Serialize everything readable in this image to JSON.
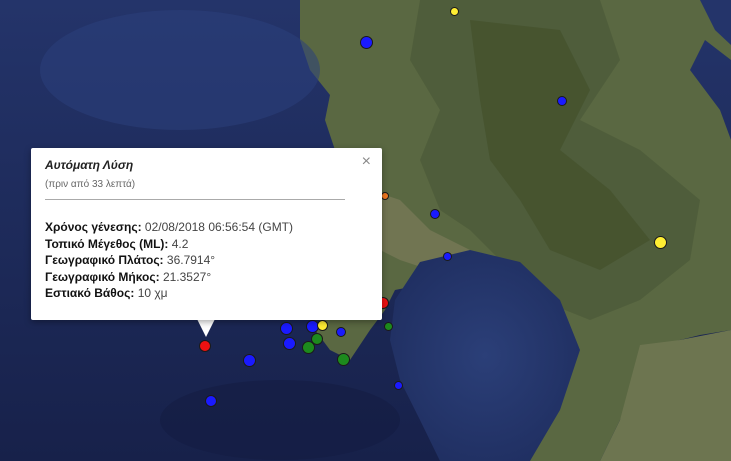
{
  "popup": {
    "close_icon": "×",
    "title": "Αυτόματη Λύση",
    "subtitle": "(πριν από 33 λεπτά)",
    "rows": [
      {
        "label": "Χρόνος γένεσης:",
        "value": "02/08/2018  06:56:54 (GMT)"
      },
      {
        "label": "Τοπικό Μέγεθος (ML):",
        "value": "4.2"
      },
      {
        "label": "Γεωγραφικό Πλάτος:",
        "value": "36.7914°"
      },
      {
        "label": "Γεωγραφικό Μήκος:",
        "value": "21.3527°"
      },
      {
        "label": "Εστιακό Βάθος:",
        "value": "10 χμ"
      }
    ]
  },
  "colors": {
    "sea": "#1d2a55",
    "land": "#5c6a45",
    "marker_blue": "#1a1aff",
    "marker_yellow": "#ffee33",
    "marker_red": "#ee1111",
    "marker_green": "#1d8a1d",
    "marker_orange": "#f07820"
  }
}
